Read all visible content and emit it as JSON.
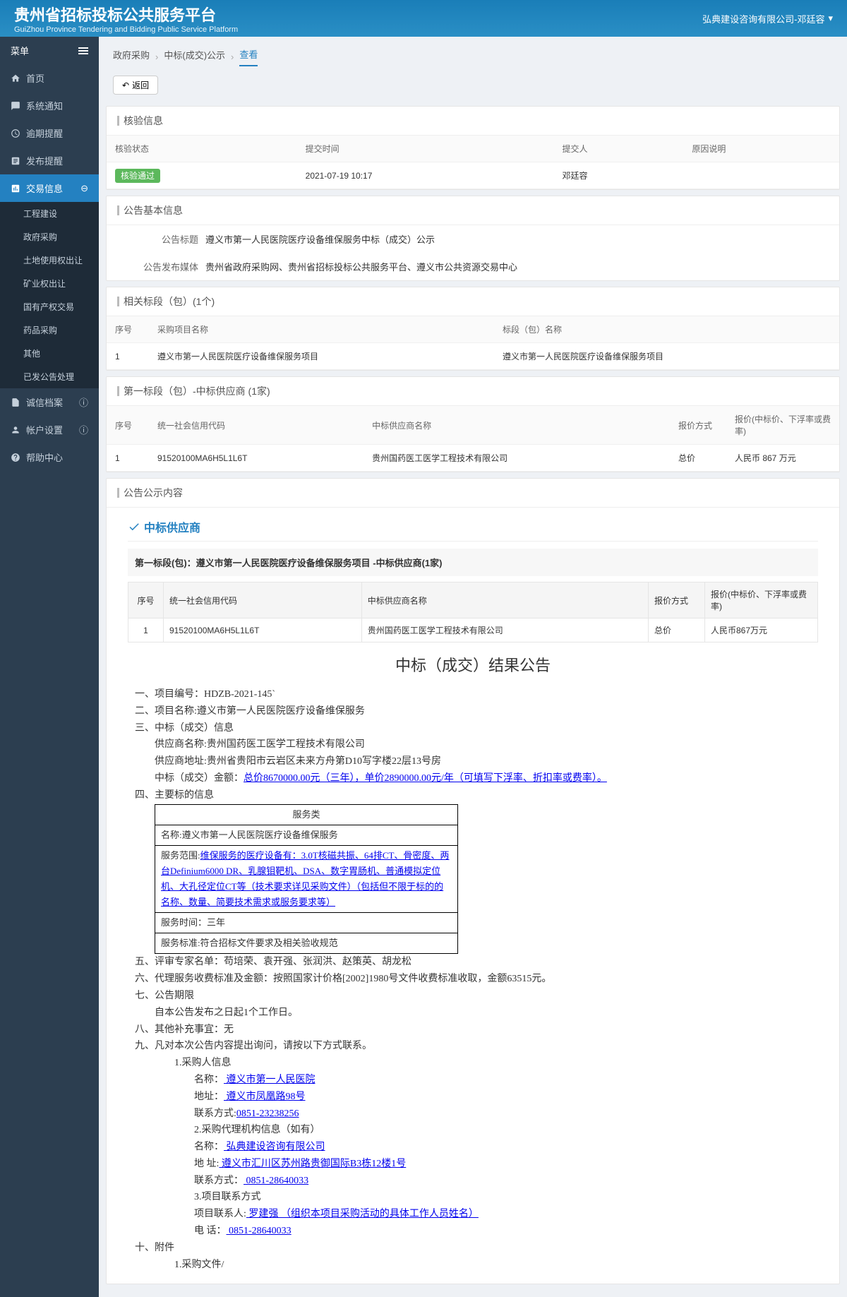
{
  "header": {
    "title": "贵州省招标投标公共服务平台",
    "subtitle": "GuiZhou Province Tendering and Bidding Public Service Platform",
    "user": "弘典建设咨询有限公司-邓廷容"
  },
  "sidebar": {
    "menu_label": "菜单",
    "items": [
      {
        "label": "首页"
      },
      {
        "label": "系统通知"
      },
      {
        "label": "逾期提醒"
      },
      {
        "label": "发布提醒"
      },
      {
        "label": "交易信息",
        "active": true,
        "sub": [
          {
            "label": "工程建设"
          },
          {
            "label": "政府采购"
          },
          {
            "label": "土地使用权出让"
          },
          {
            "label": "矿业权出让"
          },
          {
            "label": "国有产权交易"
          },
          {
            "label": "药品采购"
          },
          {
            "label": "其他"
          },
          {
            "label": "已发公告处理"
          }
        ]
      },
      {
        "label": "诚信档案",
        "dot": true
      },
      {
        "label": "帐户设置",
        "dot": true
      },
      {
        "label": "帮助中心"
      }
    ]
  },
  "breadcrumb": [
    "政府采购",
    "中标(成交)公示",
    "查看"
  ],
  "back_label": "返回",
  "panel_check": {
    "title": "核验信息",
    "headers": [
      "核验状态",
      "提交时间",
      "提交人",
      "原因说明"
    ],
    "row": {
      "status": "核验通过",
      "time": "2021-07-19 10:17",
      "submitter": "邓廷容",
      "reason": ""
    }
  },
  "panel_basic": {
    "title": "公告基本信息",
    "rows": [
      {
        "label": "公告标题",
        "value": "遵义市第一人民医院医疗设备维保服务中标（成交）公示"
      },
      {
        "label": "公告发布媒体",
        "value": "贵州省政府采购网、贵州省招标投标公共服务平台、遵义市公共资源交易中心"
      }
    ]
  },
  "panel_section": {
    "title": "相关标段（包）(1个)",
    "headers": [
      "序号",
      "采购项目名称",
      "标段（包）名称"
    ],
    "rows": [
      {
        "no": "1",
        "proj": "遵义市第一人民医院医疗设备维保服务项目",
        "sec": "遵义市第一人民医院医疗设备维保服务项目"
      }
    ]
  },
  "panel_supplier": {
    "title": "第一标段（包）-中标供应商 (1家)",
    "headers": [
      "序号",
      "统一社会信用代码",
      "中标供应商名称",
      "报价方式",
      "报价(中标价、下浮率或费率)"
    ],
    "rows": [
      {
        "no": "1",
        "code": "91520100MA6H5L1L6T",
        "name": "贵州国药医工医学工程技术有限公司",
        "method": "总价",
        "price": "人民币 867 万元"
      }
    ]
  },
  "panel_content": {
    "title": "公告公示内容",
    "supplier_label": "中标供应商",
    "sub_label": "第一标段(包)：遵义市第一人民医院医疗设备维保服务项目 -中标供应商(1家)",
    "tbl_headers": [
      "序号",
      "统一社会信用代码",
      "中标供应商名称",
      "报价方式",
      "报价(中标价、下浮率或费率)"
    ],
    "tbl_row": {
      "no": "1",
      "code": "91520100MA6H5L1L6T",
      "name": "贵州国药医工医学工程技术有限公司",
      "method": "总价",
      "price": "人民币867万元"
    },
    "notice_title": "中标（成交）结果公告",
    "notice": {
      "l1": "一、项目编号：HDZB-2021-145`",
      "l2": "二、项目名称:遵义市第一人民医院医疗设备维保服务",
      "l3": "三、中标（成交）信息",
      "l3a": "供应商名称:贵州国药医工医学工程技术有限公司",
      "l3b": "供应商地址:贵州省贵阳市云岩区未来方舟第D10写字楼22层13号房",
      "l3c_pre": "中标（成交）金额：",
      "l3c_link": "总价8670000.00元（三年），单价2890000.00元/年（可填写下浮率、折扣率或费率）。",
      "l4": "四、主要标的信息",
      "spec_header": "服务类",
      "spec_r1": "名称:遵义市第一人民医院医疗设备维保服务",
      "spec_r2_pre": "服务范围:",
      "spec_r2_link": "维保服务的医疗设备有：3.0T核磁共振、64排CT、骨密度、两台Definium6000  DR、乳腺钼靶机、DSA、数字胃肠机、普通模拟定位机、大孔径定位CT等（技术要求详见采购文件）（包括但不限于标的的名称、数量、简要技术需求或服务要求等）",
      "spec_r3": "服务时间：三年",
      "spec_r4": "服务标准:符合招标文件要求及相关验收规范",
      "l5": "五、评审专家名单：苟培荣、袁开强、张润洪、赵策英、胡龙松",
      "l6": "六、代理服务收费标准及金额：按照国家计价格[2002]1980号文件收费标准收取，金额63515元。",
      "l7": "七、公告期限",
      "l7a": "自本公告发布之日起1个工作日。",
      "l8": "八、其他补充事宜：无",
      "l9": "九、凡对本次公告内容提出询问，请按以下方式联系。",
      "l9_1": "1.采购人信息",
      "l9_1a_pre": "名称：",
      "l9_1a_link": "  遵义市第一人民医院  ",
      "l9_1b_pre": "地址：",
      "l9_1b_link": "  遵义市凤凰路98号  ",
      "l9_1c_pre": "联系方式:",
      "l9_1c_link": "0851-23238256   ",
      "l9_2": "2.采购代理机构信息（如有）",
      "l9_2a_pre": "名称：",
      "l9_2a_link": "  弘典建设咨询有限公司   ",
      "l9_2b_pre": "地  址:",
      "l9_2b_link": " 遵义市汇川区苏州路贵御国际B3栋12楼1号  ",
      "l9_2c_pre": "联系方式：",
      "l9_2c_link": " 0851-28640033   ",
      "l9_3": "3.项目联系方式",
      "l9_3a_pre": "项目联系人:",
      "l9_3a_link": " 罗建强 （组织本项目采购活动的具体工作人员姓名） ",
      "l9_3b_pre": "电   话：",
      "l9_3b_link": "  0851-28640033   ",
      "l10": "十、附件",
      "l10a": "1.采购文件/"
    }
  }
}
